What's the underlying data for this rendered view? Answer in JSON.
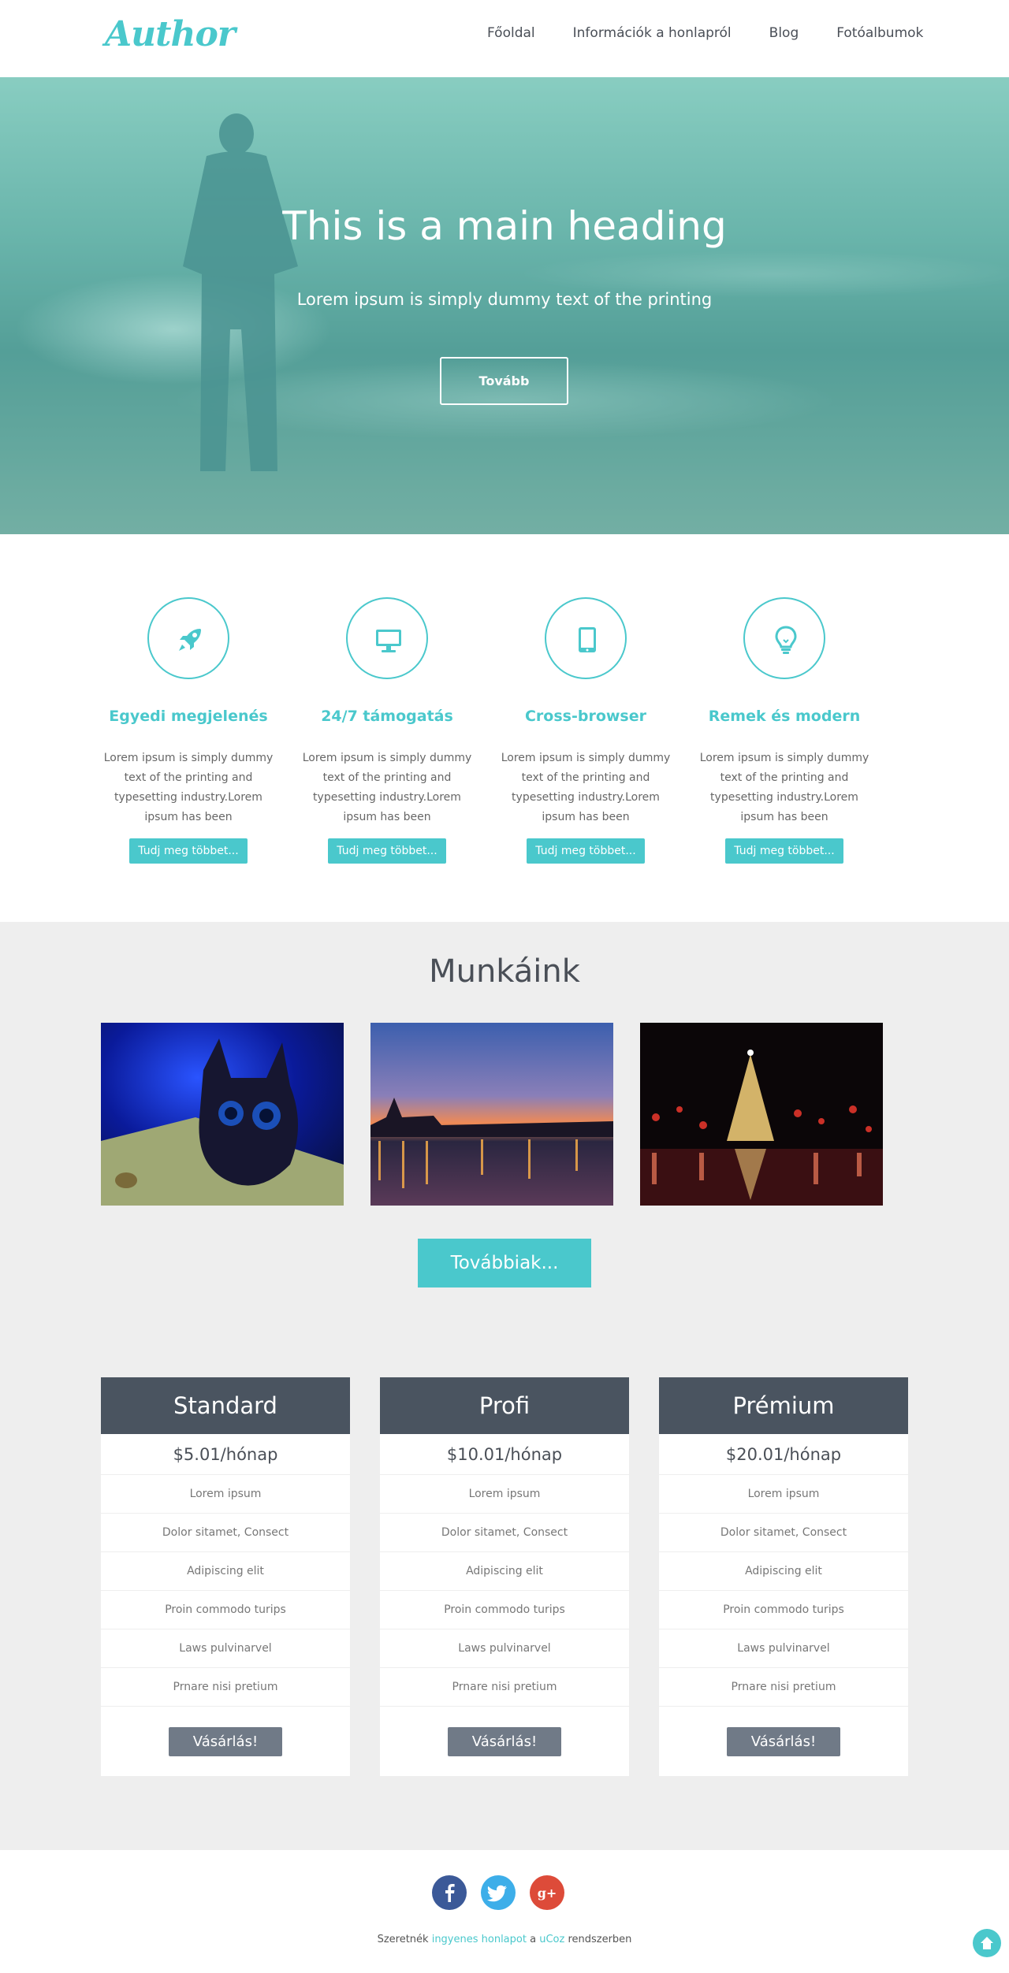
{
  "header": {
    "logo": "Author",
    "nav": [
      "Főoldal",
      "Információk a honlapról",
      "Blog",
      "Fotóalbumok"
    ]
  },
  "hero": {
    "title": "This is a main heading",
    "subtitle": "Lorem ipsum is simply dummy text of the printing",
    "button": "Tovább"
  },
  "features": [
    {
      "icon": "rocket-icon",
      "title": "Egyedi megjelenés",
      "text": "Lorem ipsum is simply dummy text of the printing and typesetting industry.Lorem ipsum has been",
      "button": "Tudj meg többet..."
    },
    {
      "icon": "monitor-icon",
      "title": "24/7 támogatás",
      "text": "Lorem ipsum is simply dummy text of the printing and typesetting industry.Lorem ipsum has been",
      "button": "Tudj meg többet..."
    },
    {
      "icon": "tablet-icon",
      "title": "Cross-browser",
      "text": "Lorem ipsum is simply dummy text of the printing and typesetting industry.Lorem ipsum has been",
      "button": "Tudj meg többet..."
    },
    {
      "icon": "lightbulb-icon",
      "title": "Remek és modern",
      "text": "Lorem ipsum is simply dummy text of the printing and typesetting industry.Lorem ipsum has been",
      "button": "Tudj meg többet..."
    }
  ],
  "works": {
    "title": "Munkáink",
    "button": "Továbbiak..."
  },
  "pricing": [
    {
      "name": "Standard",
      "price": "$5.01/hónap",
      "rows": [
        "Lorem ipsum",
        "Dolor sitamet, Consect",
        "Adipiscing elit",
        "Proin commodo turips",
        "Laws pulvinarvel",
        "Prnare nisi pretium"
      ],
      "button": "Vásárlás!"
    },
    {
      "name": "Profi",
      "price": "$10.01/hónap",
      "rows": [
        "Lorem ipsum",
        "Dolor sitamet, Consect",
        "Adipiscing elit",
        "Proin commodo turips",
        "Laws pulvinarvel",
        "Prnare nisi pretium"
      ],
      "button": "Vásárlás!"
    },
    {
      "name": "Prémium",
      "price": "$20.01/hónap",
      "rows": [
        "Lorem ipsum",
        "Dolor sitamet, Consect",
        "Adipiscing elit",
        "Proin commodo turips",
        "Laws pulvinarvel",
        "Prnare nisi pretium"
      ],
      "button": "Vásárlás!"
    }
  ],
  "footer": {
    "text_before": "Szeretnék",
    "link1": "ingyenes honlapot",
    "text_mid": "a",
    "link2": "uCoz",
    "text_after": "rendszerben"
  },
  "colors": {
    "accent": "#4ac8cc",
    "dark": "#4a5460",
    "facebook": "#3b5998",
    "twitter": "#3daee9",
    "google": "#dd4b39"
  }
}
